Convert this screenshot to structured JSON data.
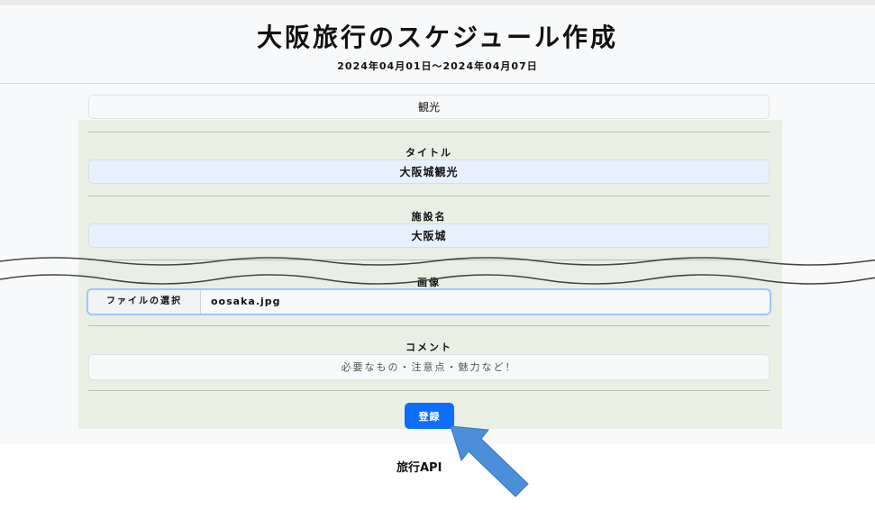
{
  "header": {
    "title": "大阪旅行のスケジュール作成",
    "date_range": "2024年04月01日〜2024年04月07日"
  },
  "category": {
    "value": "観光"
  },
  "form": {
    "title_label": "タイトル",
    "title_value": "大阪城観光",
    "facility_label": "施設名",
    "facility_value": "大阪城",
    "image_label": "画像",
    "file_button_label": "ファイルの選択",
    "file_name": "oosaka.jpg",
    "comment_label": "コメント",
    "comment_placeholder": "必要なもの・注意点・魅力など！",
    "submit_label": "登録"
  },
  "footer": {
    "text": "旅行API"
  },
  "colors": {
    "primary": "#0d6efd",
    "form_panel": "#eaefe4",
    "input_bg": "#e8f0fe",
    "arrow": "#4a8fd8"
  }
}
